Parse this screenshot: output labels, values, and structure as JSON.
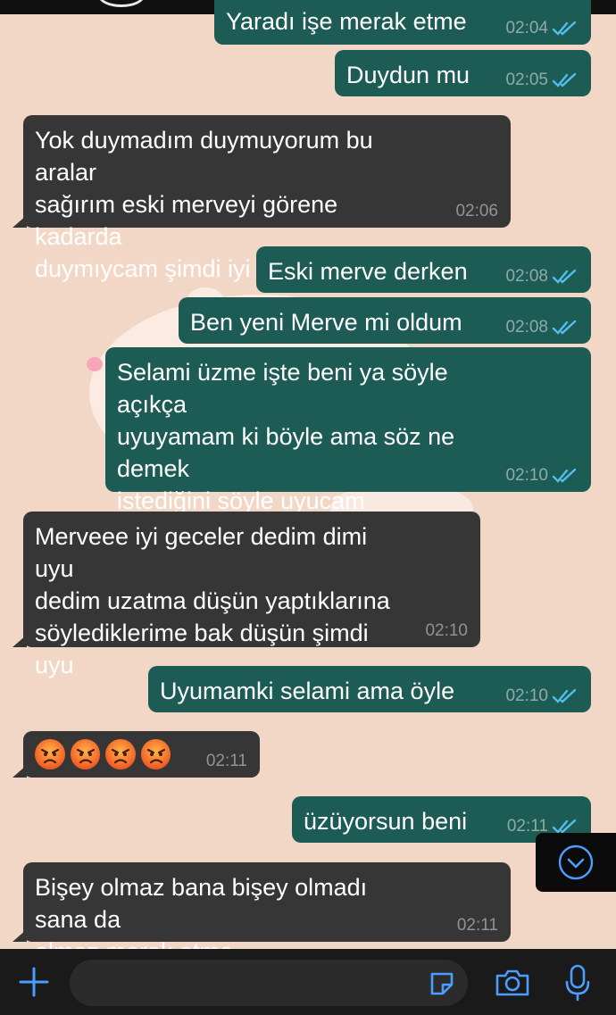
{
  "colors": {
    "background": "#f3d7c6",
    "outgoing_bubble": "#1d5b55",
    "incoming_bubble": "#363636",
    "read_ticks": "#53bdeb",
    "accent": "#4a9eff"
  },
  "messages": [
    {
      "direction": "out",
      "text": "Yaradı işe merak etme",
      "time": "02:04",
      "read": true
    },
    {
      "direction": "out",
      "text": "Duydun mu",
      "time": "02:05",
      "read": true
    },
    {
      "direction": "in",
      "text": "Yok duymadım duymuyorum bu aralar\nsağırım eski merveyi görene kadarda\nduymıycam şimdi iyi geceler UYUU",
      "time": "02:06"
    },
    {
      "direction": "out",
      "text": "Eski merve derken",
      "time": "02:08",
      "read": true
    },
    {
      "direction": "out",
      "text": "Ben yeni Merve mi oldum",
      "time": "02:08",
      "read": true
    },
    {
      "direction": "out",
      "text": "Selami üzme işte beni ya söyle açıkça\nuyuyamam ki böyle ama söz ne demek\nistediğini söyle uyucam yazmıyacam\ndaha valla bak",
      "time": "02:10",
      "read": true
    },
    {
      "direction": "in",
      "text": "Merveee iyi geceler dedim dimi uyu\ndedim uzatma düşün yaptıklarına\nsöylediklerime bak düşün şimdi uyu",
      "time": "02:10"
    },
    {
      "direction": "out",
      "text": "Uyumamki selami ama öyle",
      "time": "02:10",
      "read": true
    },
    {
      "direction": "in",
      "emoji": [
        "angry-face",
        "angry-face",
        "angry-face",
        "angry-face"
      ],
      "time": "02:11"
    },
    {
      "direction": "out",
      "text": "üzüyorsun beni",
      "time": "02:11",
      "read": true
    },
    {
      "direction": "in",
      "text": "Bişey olmaz bana bişey olmadı sana da\nolmaz merak etme",
      "time": "02:11"
    }
  ],
  "input_bar": {
    "placeholder": "",
    "icons": [
      "plus-icon",
      "sticker-icon",
      "camera-icon",
      "microphone-icon"
    ]
  },
  "scroll_down_icon": "chevron-down-circle-icon"
}
